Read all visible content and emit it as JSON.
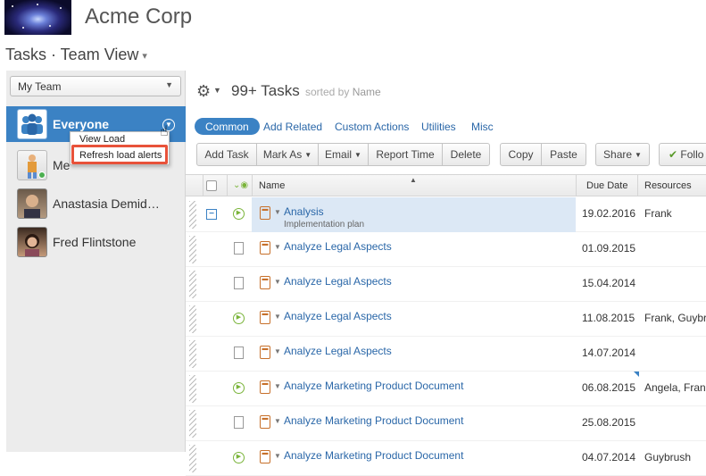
{
  "header": {
    "company": "Acme Corp"
  },
  "page": {
    "title": "Tasks · Team View",
    "title_caret": "▾"
  },
  "sidebar": {
    "team_select": "My Team",
    "members": [
      {
        "name": "Everyone",
        "active": true
      },
      {
        "name": "Me"
      },
      {
        "name": "Anastasia Demid…"
      },
      {
        "name": "Fred Flintstone"
      }
    ],
    "popup": {
      "items": [
        "View Load",
        "Refresh load alerts"
      ]
    }
  },
  "main": {
    "task_count": "99+ Tasks",
    "sorted_by_prefix": "sorted by",
    "sorted_by_field": "Name",
    "tabs": [
      "Common",
      "Add Related",
      "Custom Actions",
      "Utilities",
      "Misc"
    ],
    "toolbar": {
      "add_task": "Add Task",
      "mark_as": "Mark As",
      "email": "Email",
      "report_time": "Report Time",
      "delete": "Delete",
      "copy": "Copy",
      "paste": "Paste",
      "share": "Share",
      "follow": "Follo"
    },
    "columns": {
      "name": "Name",
      "due_date": "Due Date",
      "resources": "Resources"
    },
    "rows": [
      {
        "name": "Analysis",
        "sub": "Implementation plan",
        "due": "19.02.2016",
        "res": "Frank",
        "status": "play",
        "selected": true
      },
      {
        "name": "Analyze Legal Aspects",
        "due": "01.09.2015",
        "res": "",
        "status": "doc"
      },
      {
        "name": "Analyze Legal Aspects",
        "due": "15.04.2014",
        "res": "",
        "status": "doc"
      },
      {
        "name": "Analyze Legal Aspects",
        "due": "11.08.2015",
        "res": "Frank, Guybr",
        "status": "play"
      },
      {
        "name": "Analyze Legal Aspects",
        "due": "14.07.2014",
        "res": "",
        "status": "doc"
      },
      {
        "name": "Analyze Marketing Product Document",
        "due": "06.08.2015",
        "res": "Angela, Fran",
        "status": "play"
      },
      {
        "name": "Analyze Marketing Product Document",
        "due": "25.08.2015",
        "res": "",
        "status": "doc"
      },
      {
        "name": "Analyze Marketing Product Document",
        "due": "04.07.2014",
        "res": "Guybrush",
        "status": "play"
      }
    ]
  },
  "colors": {
    "accent": "#3b82c4",
    "link": "#2a67a8",
    "status_green": "#7ab43a",
    "task_orange": "#c7702a",
    "highlight_red": "#e8523a"
  }
}
